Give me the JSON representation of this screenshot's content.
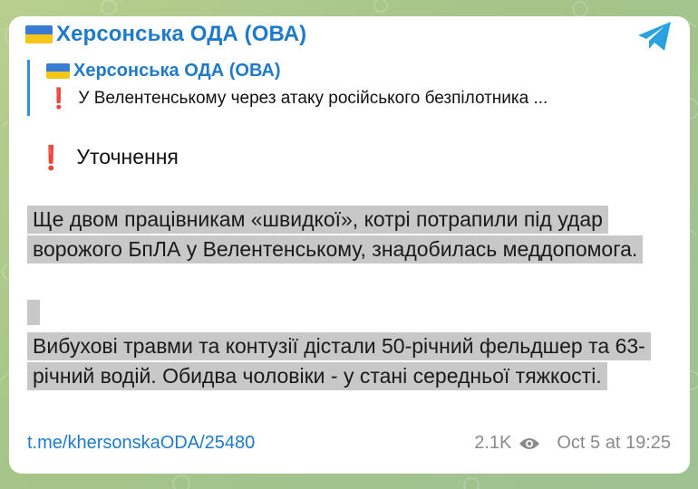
{
  "channel": {
    "name": "Херсонська ОДА (ОВА)"
  },
  "reply": {
    "name": "Херсонська ОДА (ОВА)",
    "text": "У Велентенському через атаку російського безпілотника ..."
  },
  "message": {
    "clarification": "Уточнення",
    "paragraph1": "Ще двом працівникам «швидкої», котрі потрапили під удар ворожого БпЛА у Велентенському, знадобилась меддопомога.",
    "paragraph2": "Вибухові травми та контузії дістали 50-річний фельдшер та 63-річний водій. Обидва чоловіки - у стані середньої тяжкості."
  },
  "footer": {
    "link": "t.me/khersonskaODA/25480",
    "views": "2.1K",
    "date": "Oct 5 at 19:25"
  },
  "icons": {
    "flag": "ukraine-flag-icon",
    "share": "share-icon",
    "alert": "exclamation-icon",
    "views": "eye-icon"
  },
  "colors": {
    "accent": "#1f7ac9",
    "alert": "#e0242a",
    "highlight": "#c8c8c8",
    "bubble": "#ffffff",
    "meta": "#8a8a8a"
  }
}
